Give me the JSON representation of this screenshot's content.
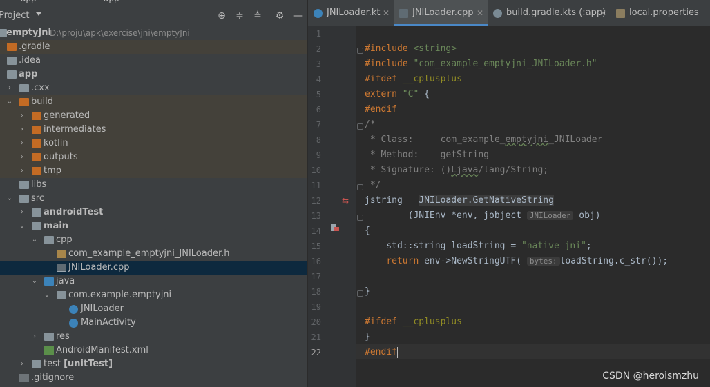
{
  "project_panel": {
    "title": "Project",
    "breadcrumb_fragments": [
      "app",
      "app"
    ],
    "tree": [
      {
        "label": "emptyJni",
        "sub": "D:\\proju\\apk\\exercise\\jni\\emptyJni",
        "bold": true
      },
      {
        "label": ".gradle"
      },
      {
        "label": ".idea"
      },
      {
        "label": "app",
        "bold": true
      },
      {
        "label": ".cxx"
      },
      {
        "label": "build"
      },
      {
        "label": "generated"
      },
      {
        "label": "intermediates"
      },
      {
        "label": "kotlin"
      },
      {
        "label": "outputs"
      },
      {
        "label": "tmp"
      },
      {
        "label": "libs"
      },
      {
        "label": "src"
      },
      {
        "label": "androidTest",
        "bold": true
      },
      {
        "label": "main",
        "bold": true
      },
      {
        "label": "cpp"
      },
      {
        "label": "com_example_emptyjni_JNILoader.h"
      },
      {
        "label": "JNILoader.cpp"
      },
      {
        "label": "java"
      },
      {
        "label": "com.example.emptyjni"
      },
      {
        "label": "JNILoader"
      },
      {
        "label": "MainActivity"
      },
      {
        "label": "res"
      },
      {
        "label": "AndroidManifest.xml"
      },
      {
        "label": "test",
        "suffix": "[unitTest]"
      },
      {
        "label": ".gitignore"
      }
    ]
  },
  "tabs": [
    {
      "label": "JNILoader.kt",
      "icon": "kotlin-file-icon"
    },
    {
      "label": "JNILoader.cpp",
      "icon": "cpp-file-icon",
      "active": true
    },
    {
      "label": "build.gradle.kts (:app)",
      "icon": "gradle-icon"
    },
    {
      "label": "local.properties",
      "icon": "properties-icon"
    }
  ],
  "editor": {
    "line_numbers": [
      "1",
      "2",
      "3",
      "4",
      "5",
      "6",
      "7",
      "8",
      "9",
      "10",
      "11",
      "12",
      "13",
      "14",
      "15",
      "16",
      "17",
      "18",
      "19",
      "20",
      "21",
      "22"
    ],
    "current_line": "22",
    "hints": {
      "jni_name": "JNILoader.GetNativeString",
      "jobject_type": "JNILoader",
      "bytes": "bytes:"
    }
  },
  "watermark": "CSDN @heroismzhu",
  "colors": {
    "keyword": "#cc7832",
    "string": "#6a8759",
    "comment": "#808080",
    "text": "#a9b7c6",
    "selection": "#0d293e",
    "accent": "#4a88c7"
  }
}
